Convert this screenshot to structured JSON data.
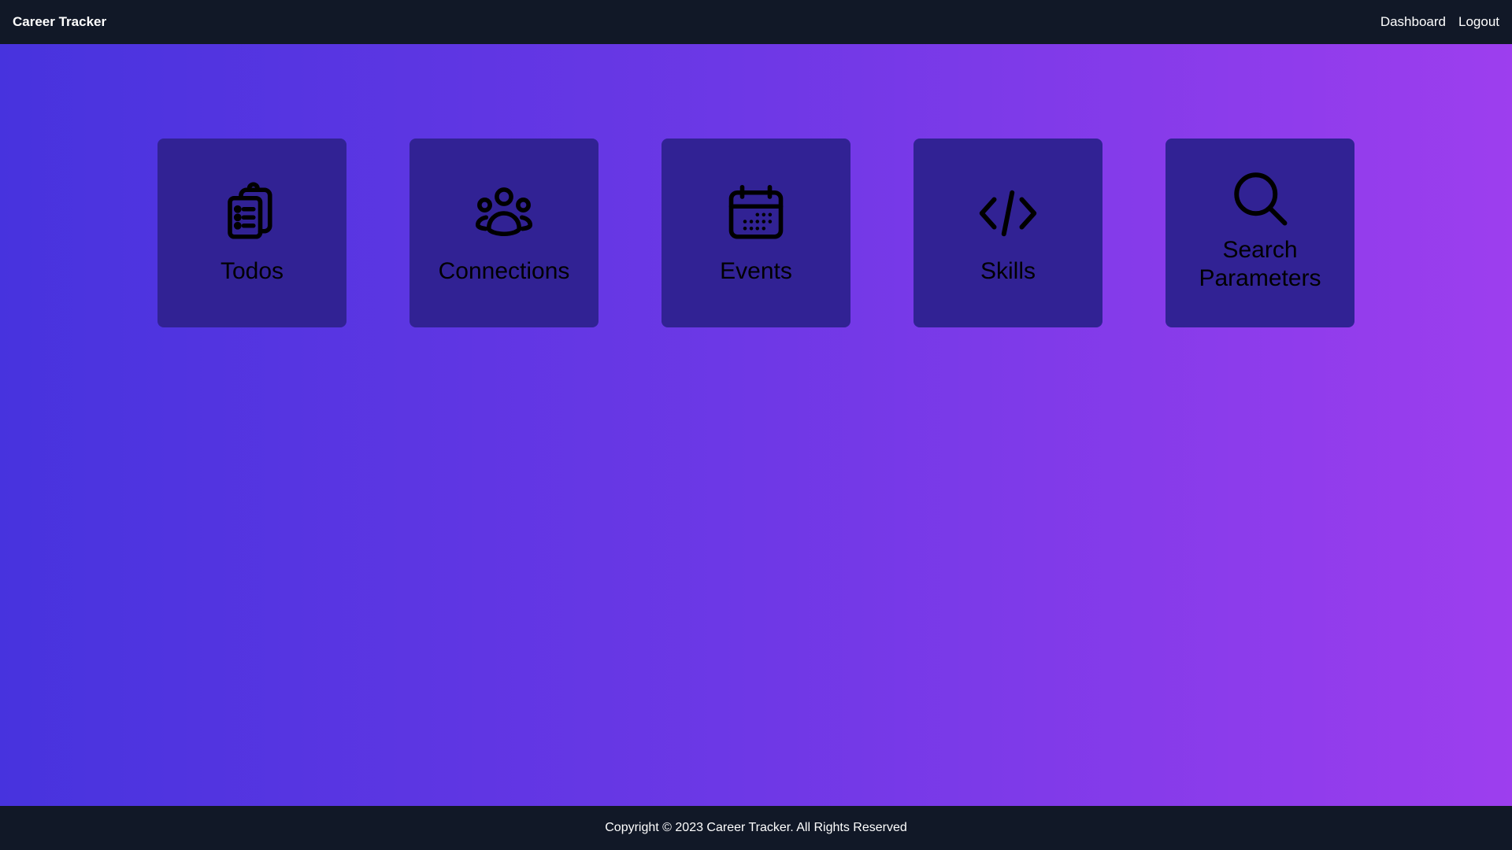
{
  "navbar": {
    "brand": "Career Tracker",
    "links": [
      "Dashboard",
      "Logout"
    ]
  },
  "cards": [
    {
      "title": "Todos",
      "icon": "clipboard-list-icon"
    },
    {
      "title": "Connections",
      "icon": "user-group-icon"
    },
    {
      "title": "Events",
      "icon": "calendar-icon"
    },
    {
      "title": "Skills",
      "icon": "code-icon"
    },
    {
      "title": "Search Parameters",
      "icon": "search-icon"
    }
  ],
  "footer": {
    "text": "Copyright © 2023 Career Tracker. All Rights Reserved"
  },
  "colors": {
    "nav_bg": "#111827",
    "gradient_start": "#4733de",
    "gradient_end": "#9d3eee",
    "card_bg": "#312294"
  }
}
